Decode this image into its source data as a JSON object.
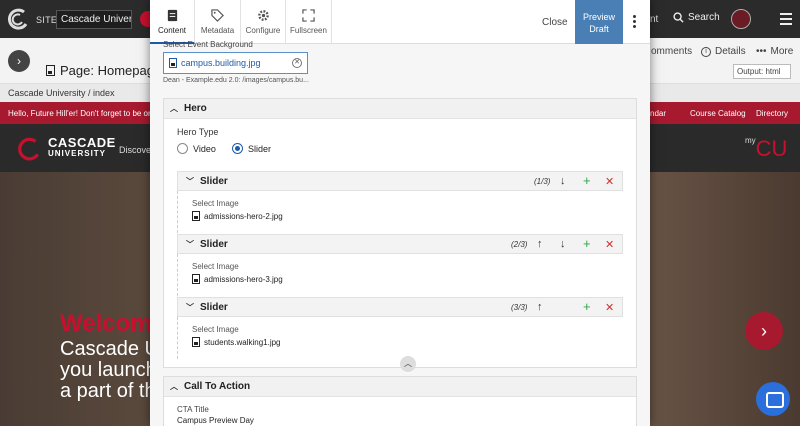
{
  "topbar": {
    "site_label": "SITE:",
    "site_value": "Cascade University",
    "nt_text": "nt",
    "search_label": "Search"
  },
  "subbar": {
    "page_title": "Page: Homepage",
    "comments_label": "omments",
    "details_label": "Details",
    "more_label": "More",
    "output_select": "Output: html"
  },
  "breadcrumb": {
    "text": "Cascade University  /  index"
  },
  "site": {
    "alert_text": "Hello, Future Hill'er! Don't forget to be on th",
    "alert_links": [
      "ndar",
      "Course Catalog",
      "Directory"
    ],
    "logo_line1": "CASCADE",
    "logo_line2": "UNIVERSITY",
    "nav_item": "Discover",
    "mycu_prefix": "my",
    "mycu_text": "CU",
    "hero_lines": [
      "Welcom",
      "Cascade Ur",
      "you launch y",
      "a part of the"
    ]
  },
  "modal": {
    "tabs": [
      {
        "label": "Content",
        "icon": "document-icon"
      },
      {
        "label": "Metadata",
        "icon": "tag-icon"
      },
      {
        "label": "Configure",
        "icon": "gear-icon"
      },
      {
        "label": "Fullscreen",
        "icon": "fullscreen-icon"
      }
    ],
    "close_label": "Close",
    "preview_label_1": "Preview",
    "preview_label_2": "Draft",
    "cut_label": "Select Event Background",
    "file_chip": "campus.building.jpg",
    "file_path": "Dean - Example.edu 2.0: /images/campus.bu...",
    "hero": {
      "title": "Hero",
      "type_label": "Hero Type",
      "options": [
        "Video",
        "Slider"
      ],
      "selected": "Slider",
      "sliders": [
        {
          "title": "Slider",
          "count": "(1/3)",
          "image_label": "Select Image",
          "image": "admissions-hero-2.jpg"
        },
        {
          "title": "Slider",
          "count": "(2/3)",
          "image_label": "Select Image",
          "image": "admissions-hero-3.jpg"
        },
        {
          "title": "Slider",
          "count": "(3/3)",
          "image_label": "Select Image",
          "image": "students.walking1.jpg"
        }
      ]
    },
    "cta": {
      "title": "Call To Action",
      "field_label": "CTA Title",
      "field_value": "Campus Preview Day"
    }
  },
  "colors": {
    "accent": "#1e5aa8",
    "brand_red": "#a6192e",
    "add_green": "#2aa84a",
    "delete_red": "#d0312d"
  }
}
